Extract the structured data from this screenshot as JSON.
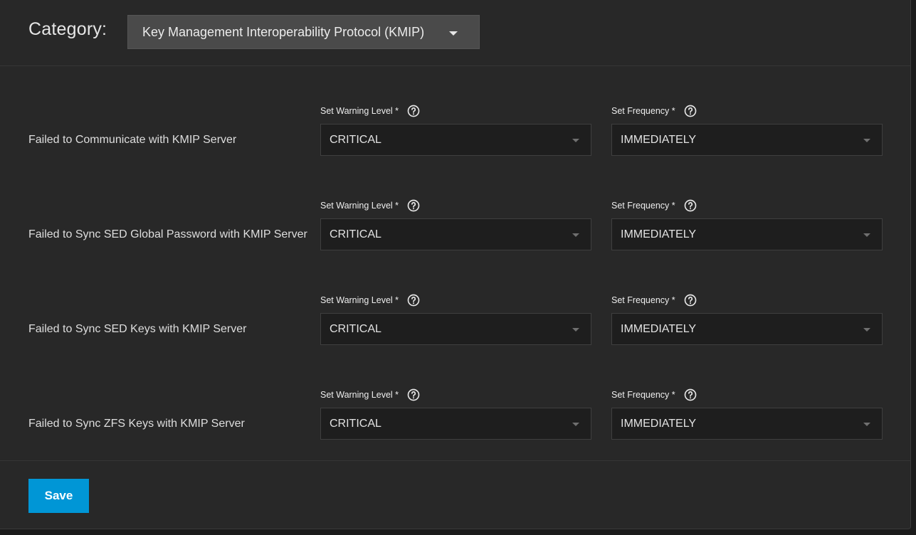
{
  "header": {
    "category_label": "Category:",
    "category_value": "Key Management Interoperability Protocol (KMIP)"
  },
  "alerts": [
    {
      "title": "Failed to Communicate with KMIP Server",
      "warning_label": "Set Warning Level *",
      "warning_value": "CRITICAL",
      "frequency_label": "Set Frequency *",
      "frequency_value": "IMMEDIATELY"
    },
    {
      "title": "Failed to Sync SED Global Password with KMIP Server",
      "warning_label": "Set Warning Level *",
      "warning_value": "CRITICAL",
      "frequency_label": "Set Frequency *",
      "frequency_value": "IMMEDIATELY"
    },
    {
      "title": "Failed to Sync SED Keys with KMIP Server",
      "warning_label": "Set Warning Level *",
      "warning_value": "CRITICAL",
      "frequency_label": "Set Frequency *",
      "frequency_value": "IMMEDIATELY"
    },
    {
      "title": "Failed to Sync ZFS Keys with KMIP Server",
      "warning_label": "Set Warning Level *",
      "warning_value": "CRITICAL",
      "frequency_label": "Set Frequency *",
      "frequency_value": "IMMEDIATELY"
    }
  ],
  "footer": {
    "save_label": "Save"
  },
  "colors": {
    "background": "#282828",
    "select_background": "#1e1e1e",
    "category_select_background": "#4a4a4a",
    "accent": "#0096d6",
    "text": "#e2e2e2"
  },
  "icons": {
    "help": "help-circle-icon",
    "dropdown": "caret-down-icon"
  }
}
